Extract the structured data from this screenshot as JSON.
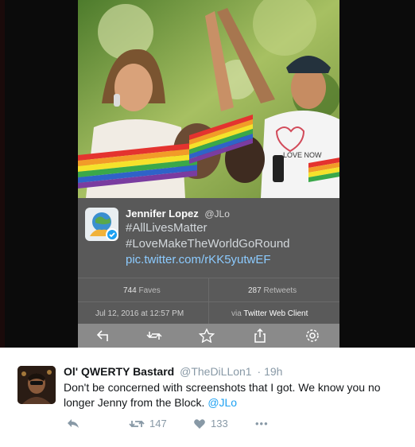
{
  "embedded": {
    "name": "Jennifer Lopez",
    "handle": "@JLo",
    "line1": "#AllLivesMatter",
    "line2": "#LoveMakeTheWorldGoRound",
    "link": "pic.twitter.com/rKK5yutwEF",
    "faves_count": "744",
    "faves_label": "Faves",
    "retweets_count": "287",
    "retweets_label": "Retweets",
    "date": "Jul 12, 2016 at 12:57 PM",
    "via_prefix": "via",
    "via_client": "Twitter Web Client",
    "photo_shirt_text": "LOVE NOW"
  },
  "reply": {
    "name": "Ol' QWERTY Bastard",
    "handle": "@TheDiLLon1",
    "separator": "·",
    "time": "19h",
    "text": "Don't be concerned with screenshots that I got. We know you no longer Jenny from the Block.",
    "mention": "@JLo",
    "retweet_count": "147",
    "like_count": "133",
    "more": "•••"
  },
  "icons": {
    "toolbar": [
      "reply-arrow-icon",
      "retweet-icon",
      "star-icon",
      "share-icon",
      "gear-icon"
    ],
    "actions": [
      "reply-icon",
      "retweet-icon",
      "heart-icon",
      "more-icon"
    ]
  },
  "colors": {
    "link_blue": "#1da1f2",
    "embedded_link": "#8ccbff",
    "verified": "#1da1f2"
  }
}
